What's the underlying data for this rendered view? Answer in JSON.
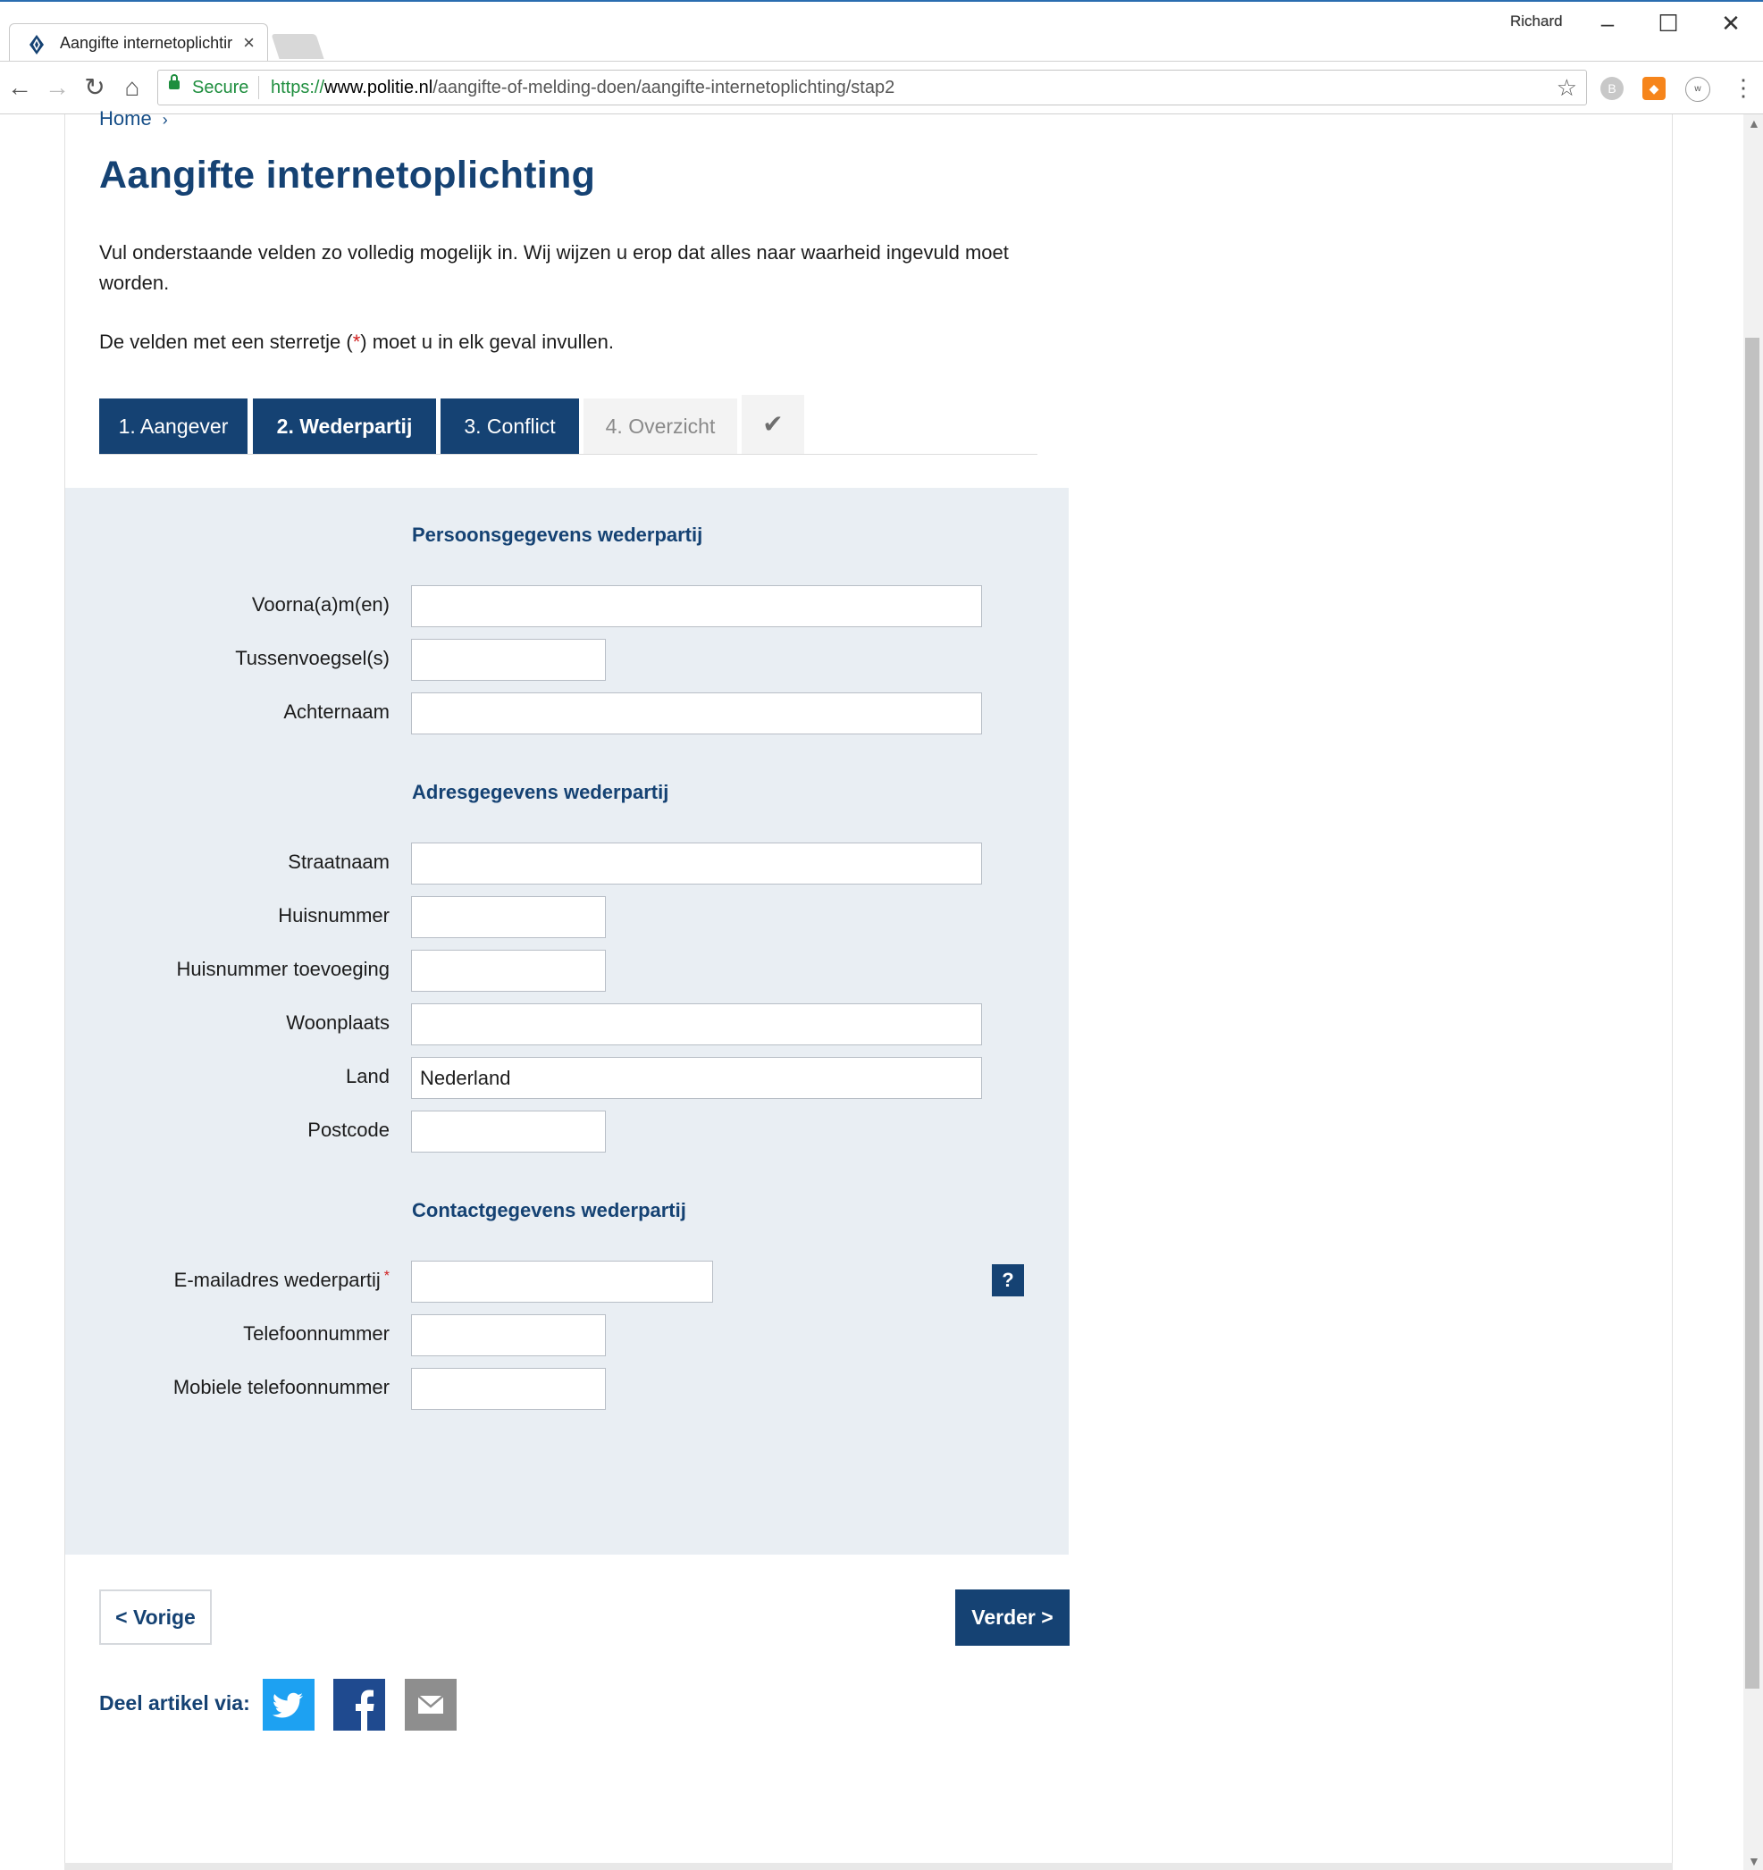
{
  "browser": {
    "tab_title": "Aangifte internetoplichtir",
    "profile_name": "Richard",
    "secure_label": "Secure",
    "url_scheme": "https://",
    "url_host": "www.politie.nl",
    "url_path": "/aangifte-of-melding-doen/aangifte-internetoplichting/stap2"
  },
  "breadcrumb": {
    "home": "Home",
    "separator": "›"
  },
  "page": {
    "title": "Aangifte internetoplichting",
    "intro": "Vul onderstaande velden zo volledig mogelijk in. Wij wijzen u erop dat alles naar waarheid ingevuld moet worden.",
    "note_before": "De velden met een sterretje (",
    "note_star": "*",
    "note_after": ") moet u in elk geval invullen."
  },
  "steps": [
    {
      "label": "1. Aangever",
      "state": "done"
    },
    {
      "label": "2. Wederpartij",
      "state": "active"
    },
    {
      "label": "3. Conflict",
      "state": "done"
    },
    {
      "label": "4. Overzicht",
      "state": "disabled"
    }
  ],
  "form": {
    "sections": {
      "person": "Persoonsgegevens wederpartij",
      "address": "Adresgegevens wederpartij",
      "contact": "Contactgegevens wederpartij"
    },
    "fields": {
      "firstnames": {
        "label": "Voorna(a)m(en)",
        "value": ""
      },
      "infix": {
        "label": "Tussenvoegsel(s)",
        "value": ""
      },
      "lastname": {
        "label": "Achternaam",
        "value": ""
      },
      "street": {
        "label": "Straatnaam",
        "value": ""
      },
      "housenumber": {
        "label": "Huisnummer",
        "value": ""
      },
      "housenumber_suffix": {
        "label": "Huisnummer toevoeging",
        "value": ""
      },
      "city": {
        "label": "Woonplaats",
        "value": ""
      },
      "country": {
        "label": "Land",
        "value": "Nederland"
      },
      "postcode": {
        "label": "Postcode",
        "value": ""
      },
      "email": {
        "label": "E-mailadres wederpartij",
        "required_mark": "*",
        "value": ""
      },
      "phone": {
        "label": "Telefoonnummer",
        "value": ""
      },
      "mobile": {
        "label": "Mobiele telefoonnummer",
        "value": ""
      }
    },
    "help_label": "?"
  },
  "navigation": {
    "prev": "<  Vorige",
    "next": "Verder >"
  },
  "share": {
    "label": "Deel artikel via:",
    "icons": [
      "twitter-icon",
      "facebook-icon",
      "mail-icon"
    ]
  },
  "colors": {
    "primary": "#154273",
    "panel": "#e9eef3",
    "required": "#d01e1e",
    "twitter": "#1da1f2",
    "facebook": "#1f4a8f"
  }
}
